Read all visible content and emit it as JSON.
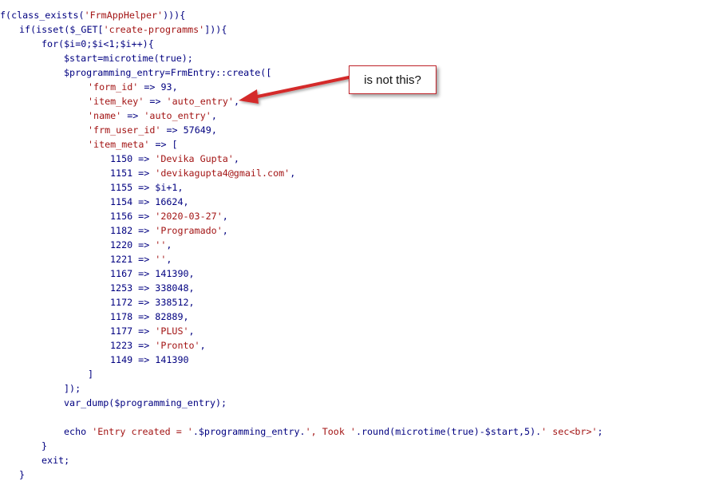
{
  "code_lines": [
    {
      "indent": 0,
      "segs": [
        [
          "p",
          "f(class_exists("
        ],
        [
          "s",
          "'FrmAppHelper'"
        ],
        [
          "p",
          "))){"
        ]
      ]
    },
    {
      "indent": 24,
      "segs": [
        [
          "p",
          "if(isset($_GET["
        ],
        [
          "s",
          "'create-programms'"
        ],
        [
          "p",
          "])){"
        ]
      ]
    },
    {
      "indent": 52,
      "segs": [
        [
          "p",
          "for($i=0;$i<1;$i++){"
        ]
      ]
    },
    {
      "indent": 80,
      "segs": [
        [
          "p",
          "$start=microtime(true);"
        ]
      ]
    },
    {
      "indent": 80,
      "segs": [
        [
          "p",
          "$programming_entry=FrmEntry::create(["
        ]
      ]
    },
    {
      "indent": 110,
      "segs": [
        [
          "s",
          "'form_id'"
        ],
        [
          "p",
          " => 93,"
        ]
      ]
    },
    {
      "indent": 110,
      "segs": [
        [
          "s",
          "'item_key'"
        ],
        [
          "p",
          " => "
        ],
        [
          "s",
          "'auto_entry'"
        ],
        [
          "p",
          ","
        ]
      ]
    },
    {
      "indent": 110,
      "segs": [
        [
          "s",
          "'name'"
        ],
        [
          "p",
          " => "
        ],
        [
          "s",
          "'auto_entry'"
        ],
        [
          "p",
          ","
        ]
      ]
    },
    {
      "indent": 110,
      "segs": [
        [
          "s",
          "'frm_user_id'"
        ],
        [
          "p",
          " => 57649,"
        ]
      ]
    },
    {
      "indent": 110,
      "segs": [
        [
          "s",
          "'item_meta'"
        ],
        [
          "p",
          " => ["
        ]
      ]
    },
    {
      "indent": 138,
      "segs": [
        [
          "p",
          "1150 => "
        ],
        [
          "s",
          "'Devika Gupta'"
        ],
        [
          "p",
          ","
        ]
      ]
    },
    {
      "indent": 138,
      "segs": [
        [
          "p",
          "1151 => "
        ],
        [
          "s",
          "'devikagupta4@gmail.com'"
        ],
        [
          "p",
          ","
        ]
      ]
    },
    {
      "indent": 138,
      "segs": [
        [
          "p",
          "1155 => $i+1,"
        ]
      ]
    },
    {
      "indent": 138,
      "segs": [
        [
          "p",
          "1154 => 16624,"
        ]
      ]
    },
    {
      "indent": 138,
      "segs": [
        [
          "p",
          "1156 => "
        ],
        [
          "s",
          "'2020-03-27'"
        ],
        [
          "p",
          ","
        ]
      ]
    },
    {
      "indent": 138,
      "segs": [
        [
          "p",
          "1182 => "
        ],
        [
          "s",
          "'Programado'"
        ],
        [
          "p",
          ","
        ]
      ]
    },
    {
      "indent": 138,
      "segs": [
        [
          "p",
          "1220 => "
        ],
        [
          "s",
          "''"
        ],
        [
          "p",
          ","
        ]
      ]
    },
    {
      "indent": 138,
      "segs": [
        [
          "p",
          "1221 => "
        ],
        [
          "s",
          "''"
        ],
        [
          "p",
          ","
        ]
      ]
    },
    {
      "indent": 138,
      "segs": [
        [
          "p",
          "1167 => 141390,"
        ]
      ]
    },
    {
      "indent": 138,
      "segs": [
        [
          "p",
          "1253 => 338048,"
        ]
      ]
    },
    {
      "indent": 138,
      "segs": [
        [
          "p",
          "1172 => 338512,"
        ]
      ]
    },
    {
      "indent": 138,
      "segs": [
        [
          "p",
          "1178 => 82889,"
        ]
      ]
    },
    {
      "indent": 138,
      "segs": [
        [
          "p",
          "1177 => "
        ],
        [
          "s",
          "'PLUS'"
        ],
        [
          "p",
          ","
        ]
      ]
    },
    {
      "indent": 138,
      "segs": [
        [
          "p",
          "1223 => "
        ],
        [
          "s",
          "'Pronto'"
        ],
        [
          "p",
          ","
        ]
      ]
    },
    {
      "indent": 138,
      "segs": [
        [
          "p",
          "1149 => 141390"
        ]
      ]
    },
    {
      "indent": 110,
      "segs": [
        [
          "p",
          "]"
        ]
      ]
    },
    {
      "indent": 80,
      "segs": [
        [
          "p",
          "]);"
        ]
      ]
    },
    {
      "indent": 80,
      "segs": [
        [
          "p",
          "var_dump($programming_entry);"
        ]
      ]
    },
    {
      "indent": 0,
      "segs": [
        [
          "p",
          ""
        ]
      ]
    },
    {
      "indent": 80,
      "segs": [
        [
          "p",
          "echo "
        ],
        [
          "s",
          "'Entry created = '"
        ],
        [
          "p",
          ".$programming_entry."
        ],
        [
          "s",
          "', Took '"
        ],
        [
          "p",
          ".round(microtime(true)-$start,5)."
        ],
        [
          "s",
          "' sec<br>'"
        ],
        [
          "p",
          ";"
        ]
      ]
    },
    {
      "indent": 52,
      "segs": [
        [
          "p",
          "}"
        ]
      ]
    },
    {
      "indent": 52,
      "segs": [
        [
          "p",
          "exit;"
        ]
      ]
    },
    {
      "indent": 24,
      "segs": [
        [
          "p",
          "}"
        ]
      ]
    }
  ],
  "callout": {
    "text": "is not this?"
  },
  "colors": {
    "string": "#a31515",
    "code": "#000080",
    "annotation": "#d42a2a"
  }
}
